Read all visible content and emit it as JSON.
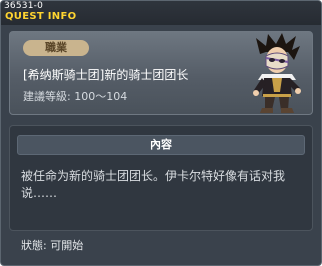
{
  "window": {
    "quest_id": "36531-0",
    "title": "QUEST INFO"
  },
  "quest": {
    "job_label": "職業",
    "name": "[希纳斯骑士团]新的骑士团团长",
    "level": "建議等級: 100～104",
    "avatar_icon": "character-avatar-icon"
  },
  "content": {
    "header": "內容",
    "text": "被任命为新的骑士团团长。伊卡尔特好像有话对我说……"
  },
  "status": {
    "text": "狀態:  可開始"
  },
  "colors": {
    "title_accent": "#ffd530",
    "badge": "#c9b48e",
    "panel": "#3a424c"
  }
}
